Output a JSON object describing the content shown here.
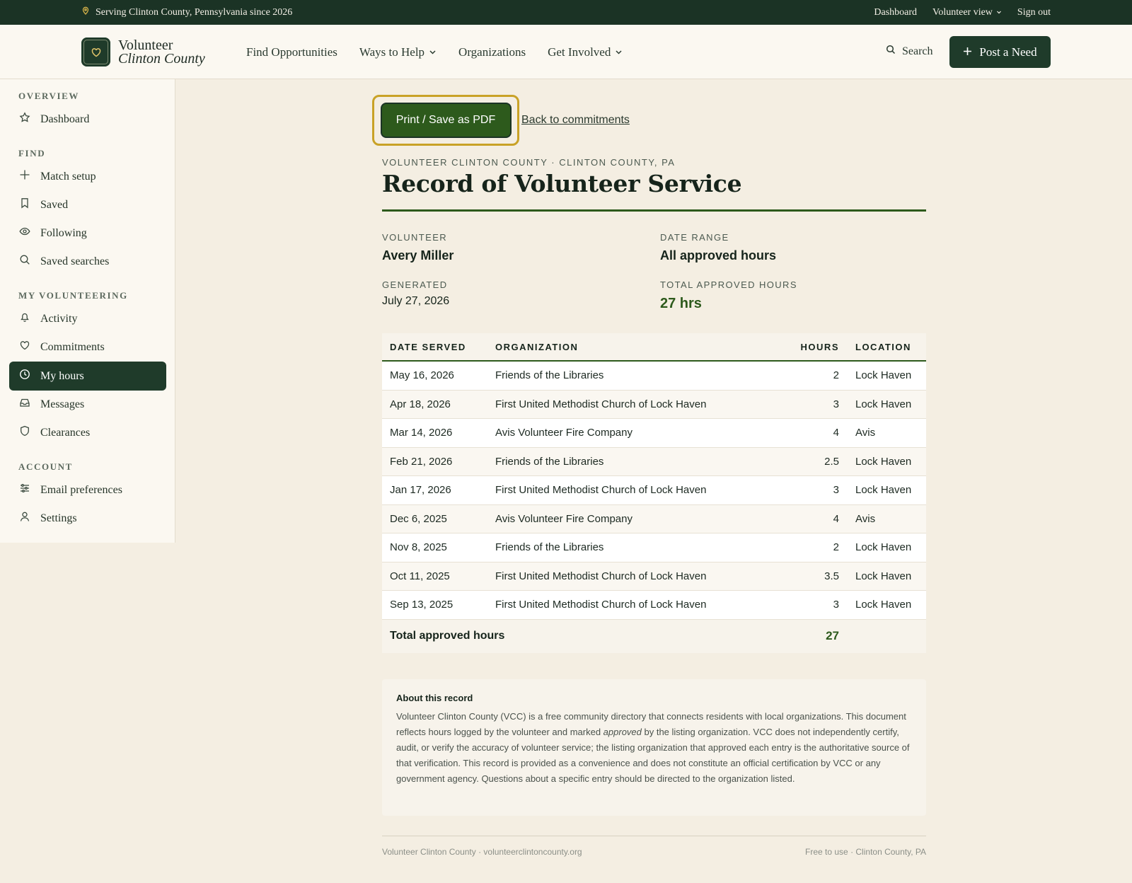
{
  "topbar": {
    "location_text": "Serving Clinton County, Pennsylvania since 2026",
    "links": {
      "dashboard": "Dashboard",
      "volunteer_view": "Volunteer view",
      "sign_out": "Sign out"
    }
  },
  "header": {
    "logo_line1": "Volunteer",
    "logo_line2": "Clinton County",
    "nav": {
      "find": "Find Opportunities",
      "ways": "Ways to Help",
      "orgs": "Organizations",
      "involved": "Get Involved"
    },
    "search_label": "Search",
    "post_label": "Post a Need"
  },
  "sidebar": {
    "sections": {
      "overview": "OVERVIEW",
      "find": "FIND",
      "my_volunteering": "MY VOLUNTEERING",
      "account": "ACCOUNT"
    },
    "items": {
      "dashboard": "Dashboard",
      "match_setup": "Match setup",
      "saved": "Saved",
      "following": "Following",
      "saved_searches": "Saved searches",
      "activity": "Activity",
      "commitments": "Commitments",
      "my_hours": "My hours",
      "messages": "Messages",
      "clearances": "Clearances",
      "email_prefs": "Email preferences",
      "settings": "Settings"
    },
    "active": "my_hours"
  },
  "actions": {
    "print_label": "Print / Save as PDF",
    "back_label": "Back to commitments"
  },
  "record": {
    "eyebrow": "VOLUNTEER CLINTON COUNTY · CLINTON COUNTY, PA",
    "title": "Record of Volunteer Service",
    "volunteer_label": "VOLUNTEER",
    "volunteer_name": "Avery Miller",
    "range_label": "DATE RANGE",
    "range_value": "All approved hours",
    "generated_label": "GENERATED",
    "generated_value": "July 27, 2026",
    "total_label": "TOTAL APPROVED HOURS",
    "total_value": "27 hrs"
  },
  "table": {
    "headers": {
      "date": "DATE SERVED",
      "org": "ORGANIZATION",
      "hours": "HOURS",
      "location": "LOCATION"
    },
    "rows": [
      {
        "date": "May 16, 2026",
        "org": "Friends of the Libraries",
        "hours": "2",
        "location": "Lock Haven"
      },
      {
        "date": "Apr 18, 2026",
        "org": "First United Methodist Church of Lock Haven",
        "hours": "3",
        "location": "Lock Haven"
      },
      {
        "date": "Mar 14, 2026",
        "org": "Avis Volunteer Fire Company",
        "hours": "4",
        "location": "Avis"
      },
      {
        "date": "Feb 21, 2026",
        "org": "Friends of the Libraries",
        "hours": "2.5",
        "location": "Lock Haven"
      },
      {
        "date": "Jan 17, 2026",
        "org": "First United Methodist Church of Lock Haven",
        "hours": "3",
        "location": "Lock Haven"
      },
      {
        "date": "Dec 6, 2025",
        "org": "Avis Volunteer Fire Company",
        "hours": "4",
        "location": "Avis"
      },
      {
        "date": "Nov 8, 2025",
        "org": "Friends of the Libraries",
        "hours": "2",
        "location": "Lock Haven"
      },
      {
        "date": "Oct 11, 2025",
        "org": "First United Methodist Church of Lock Haven",
        "hours": "3.5",
        "location": "Lock Haven"
      },
      {
        "date": "Sep 13, 2025",
        "org": "First United Methodist Church of Lock Haven",
        "hours": "3",
        "location": "Lock Haven"
      }
    ],
    "total_label": "Total approved hours",
    "total_value": "27"
  },
  "about": {
    "heading": "About this record",
    "text_before": "Volunteer Clinton County (VCC) is a free community directory that connects residents with local organizations. This document reflects hours logged by the volunteer and marked ",
    "text_em": "approved",
    "text_after": " by the listing organization. VCC does not independently certify, audit, or verify the accuracy of volunteer service; the listing organization that approved each entry is the authoritative source of that verification. This record is provided as a convenience and does not constitute an official certification by VCC or any government agency. Questions about a specific entry should be directed to the organization listed."
  },
  "footer": {
    "left": "Volunteer Clinton County · volunteerclintoncounty.org",
    "right": "Free to use · Clinton County, PA"
  },
  "colors": {
    "dark_green": "#1f3b2a",
    "accent_green": "#2d5a1c",
    "focus_gold": "#c9a227",
    "page_bg": "#f4eee2"
  }
}
